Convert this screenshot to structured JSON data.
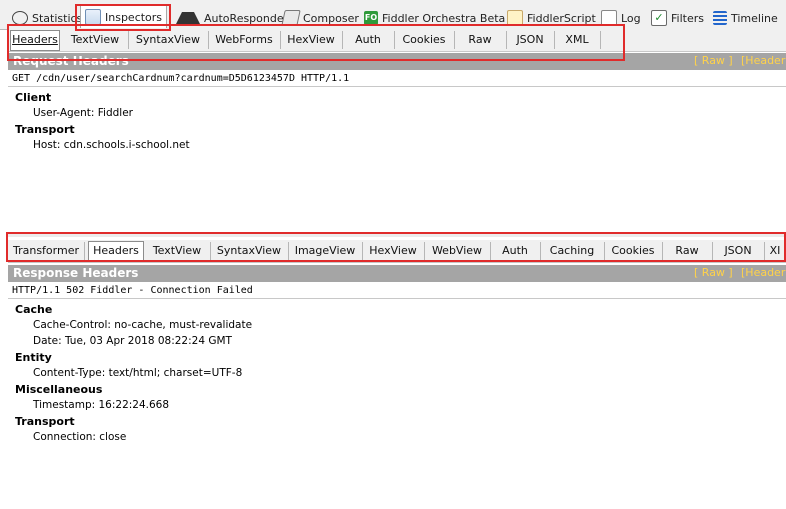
{
  "top_tabs": [
    {
      "label": "Statistics",
      "icon": "stopwatch-icon"
    },
    {
      "label": "Inspectors",
      "icon": "inspector-icon",
      "active": true
    },
    {
      "label": "AutoResponder",
      "icon": "lightning-icon"
    },
    {
      "label": "Composer",
      "icon": "pencil-icon"
    },
    {
      "label": "Fiddler Orchestra Beta",
      "icon": "orchestra-icon",
      "icon_text": "FO"
    },
    {
      "label": "FiddlerScript",
      "icon": "script-icon"
    },
    {
      "label": "Log",
      "icon": "log-icon"
    },
    {
      "label": "Filters",
      "icon": "checkbox-icon"
    },
    {
      "label": "Timeline",
      "icon": "timeline-icon"
    }
  ],
  "request": {
    "tabs": [
      "Headers",
      "TextView",
      "SyntaxView",
      "WebForms",
      "HexView",
      "Auth",
      "Cookies",
      "Raw",
      "JSON",
      "XML"
    ],
    "selected_tab": "Headers",
    "section_title": "Request Headers",
    "link_raw": "[ Raw ]",
    "link_header_defs": "[Header",
    "request_line": "GET /cdn/user/searchCardnum?cardnum=D5D6123457D HTTP/1.1",
    "groups": [
      {
        "name": "Client",
        "headers": [
          "User-Agent: Fiddler"
        ]
      },
      {
        "name": "Transport",
        "headers": [
          "Host: cdn.schools.i-school.net"
        ]
      }
    ]
  },
  "response": {
    "tabs": [
      "Transformer",
      "Headers",
      "TextView",
      "SyntaxView",
      "ImageView",
      "HexView",
      "WebView",
      "Auth",
      "Caching",
      "Cookies",
      "Raw",
      "JSON",
      "XI"
    ],
    "selected_tab": "Headers",
    "section_title": "Response Headers",
    "link_raw": "[ Raw ]",
    "link_header_defs": "[Header",
    "status_line": "HTTP/1.1 502 Fiddler - Connection Failed",
    "groups": [
      {
        "name": "Cache",
        "headers": [
          "Cache-Control: no-cache, must-revalidate",
          "Date: Tue, 03 Apr 2018 08:22:24 GMT"
        ]
      },
      {
        "name": "Entity",
        "headers": [
          "Content-Type: text/html; charset=UTF-8"
        ]
      },
      {
        "name": "Miscellaneous",
        "headers": [
          "Timestamp: 16:22:24.668"
        ]
      },
      {
        "name": "Transport",
        "headers": [
          "Connection: close"
        ]
      }
    ]
  },
  "colors": {
    "highlight": "#e02b2b",
    "header_bar": "#a5a5a5",
    "link": "#ffd24a"
  }
}
